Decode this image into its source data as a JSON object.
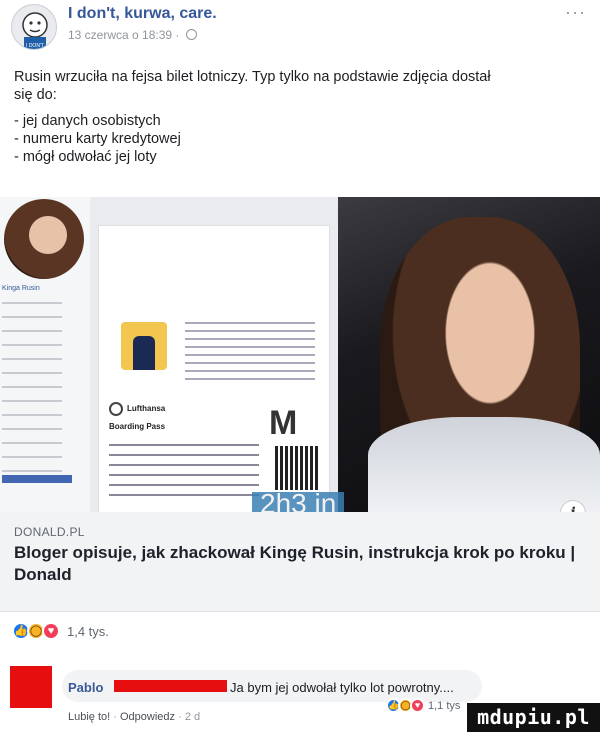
{
  "post": {
    "author": "I don't, kurwa, care.",
    "date": "13 czerwca o 18:39 ·",
    "more": "···",
    "text_lines": [
      "Rusin wrzuciła na fejsa bilet lotniczy. Typ tylko na podstawie zdjęcia dostał",
      "się do:",
      "",
      "- jej danych osobistych",
      "- numeru karty kredytowej",
      "- mógł odwołać jej loty"
    ]
  },
  "preview": {
    "ticket_airline": "Lufthansa",
    "ticket_title": "Boarding Pass",
    "ticket_letter": "M",
    "profile_name": "Kinga Rusin",
    "overlay_text": "2h3 in",
    "info_icon": "i"
  },
  "link": {
    "domain": "DONALD.PL",
    "title": "Bloger opisuje, jak zhackował Kingę Rusin, instrukcja krok po kroku | Donald"
  },
  "reactions": {
    "icons": [
      "like-icon",
      "wow-icon",
      "love-icon"
    ],
    "count": "1,4 tys."
  },
  "comment": {
    "name": "Pablo",
    "text": "Ja bym jej odwołał tylko lot powrotny....",
    "actions": [
      "Lubię to!",
      "·",
      "Odpowiedz",
      "·",
      "2 d"
    ],
    "reaction_count": "1,1 tys"
  },
  "brand": "mdupiu.pl",
  "colors": {
    "link_blue": "#365899",
    "redaction_red": "#e60e0e",
    "like_blue": "#1877f2"
  }
}
